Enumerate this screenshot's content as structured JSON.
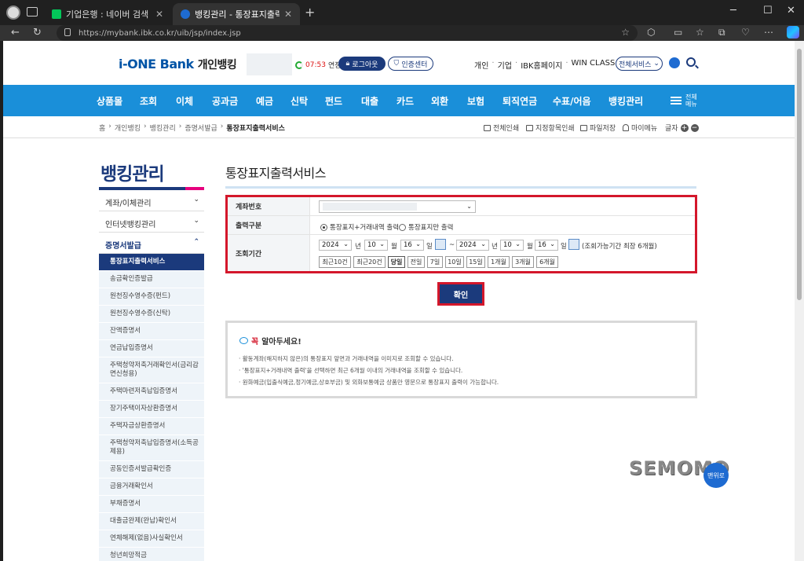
{
  "browser": {
    "tabs": [
      {
        "title": "기업은행 : 네이버 검색"
      },
      {
        "title": "뱅킹관리 - 통장표지출력서비스 |"
      }
    ],
    "url": "https://mybank.ibk.co.kr/uib/jsp/index.jsp"
  },
  "header": {
    "logo_main": "i-ONE Bank",
    "logo_sub": "개인뱅킹",
    "timer": "07:53",
    "extend_label": "연장",
    "logout_label": "로그아웃",
    "cert_label": "인증센터",
    "links": [
      "개인",
      "기업",
      "IBK홈페이지",
      "WIN CLASS"
    ],
    "all_services": "전체서비스"
  },
  "mainnav": {
    "items": [
      "상품몰",
      "조회",
      "이체",
      "공과금",
      "예금",
      "신탁",
      "펀드",
      "대출",
      "카드",
      "외환",
      "보험",
      "퇴직연금",
      "수표/어음",
      "뱅킹관리"
    ],
    "all_menu": "전체메뉴"
  },
  "breadcrumb": [
    "홈",
    "개인뱅킹",
    "뱅킹관리",
    "증명서발급",
    "통장표지출력서비스"
  ],
  "utilities": {
    "print_all": "전체인쇄",
    "print_selected": "지정항목인쇄",
    "save_file": "파일저장",
    "my_menu": "마이메뉴",
    "font": "글자"
  },
  "sidebar": {
    "title": "뱅킹관리",
    "main_items": [
      "계좌/이체관리",
      "인터넷뱅킹관리",
      "증명서발급"
    ],
    "sub_items": [
      "통장표지출력서비스",
      "송금확인증발급",
      "원천징수영수증(펀드)",
      "원천징수영수증(신탁)",
      "잔액증명서",
      "연금납입증명서",
      "주택청약저축거래확인서(금리감면신청용)",
      "주택마련저축납입증명서",
      "장기주택이자상환증명서",
      "주택자금상환증명서",
      "주택청약저축납입증명서(소득공제용)",
      "공동인증서발급확인증",
      "금융거래확인서",
      "부채증명서",
      "대출금완제(완납)확인서",
      "연체해제(없음)사실확인서",
      "청년희망적금"
    ]
  },
  "content": {
    "title": "통장표지출력서비스",
    "account_label": "계좌번호",
    "output_label": "출력구분",
    "output_options": [
      "통장표지+거래내역 출력",
      "통장표지만 출력"
    ],
    "period_label": "조회기간",
    "from": {
      "year": "2024",
      "month": "10",
      "day": "16"
    },
    "to": {
      "year": "2024",
      "month": "10",
      "day": "16"
    },
    "unit_year": "년",
    "unit_month": "월",
    "unit_day": "일",
    "tilde": "~",
    "range_note": "(조회가능기간 최장 6개월)",
    "quick_buttons": [
      "최근10건",
      "최근20건",
      "당일",
      "전일",
      "7일",
      "10일",
      "15일",
      "1개월",
      "3개월",
      "6개월"
    ],
    "confirm_label": "확인"
  },
  "notice": {
    "title_prefix": "꼭",
    "title_rest": "알아두세요!",
    "items": [
      "활동계좌(해지하지 않은)의 통장표지 앞면과 거래내역을 이미지로 조회할 수 있습니다.",
      "'통장표지+거래내역 출력'을 선택하면 최근 6개월 이내의 거래내역을 조회할 수 있습니다.",
      "원화예금(입출식예금,정기예금,상호부금) 및 외화보통예금 상품만 영문으로 통장표지 출력이 가능합니다."
    ]
  },
  "watermark": "SEMOMO",
  "top_button": "맨위로"
}
